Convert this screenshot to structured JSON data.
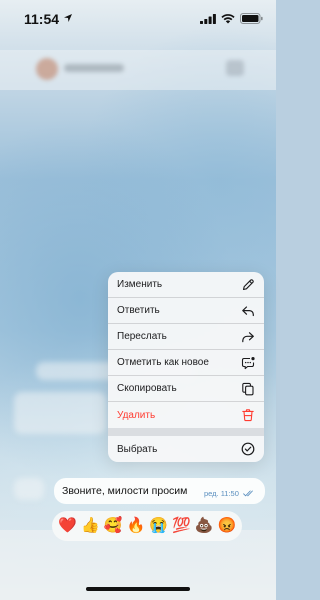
{
  "status_bar": {
    "time": "11:54"
  },
  "context_menu": {
    "items": [
      {
        "label": "Изменить",
        "icon": "pencil-icon"
      },
      {
        "label": "Ответить",
        "icon": "reply-icon"
      },
      {
        "label": "Переслать",
        "icon": "forward-icon"
      },
      {
        "label": "Отметить как новое",
        "icon": "unread-icon"
      },
      {
        "label": "Скопировать",
        "icon": "copy-icon"
      },
      {
        "label": "Удалить",
        "icon": "trash-icon",
        "color": "#ff3b30"
      }
    ],
    "select_item": {
      "label": "Выбрать",
      "icon": "checkmark-circle-icon"
    }
  },
  "message": {
    "text": "Звоните, милости просим",
    "edited": "ред.",
    "time": "11:50"
  },
  "reactions": [
    "❤️",
    "👍",
    "🥰",
    "🔥",
    "😭",
    "💯",
    "💩",
    "😡"
  ],
  "colors": {
    "destructive": "#ff3b30",
    "meta": "#5a8fbf"
  }
}
